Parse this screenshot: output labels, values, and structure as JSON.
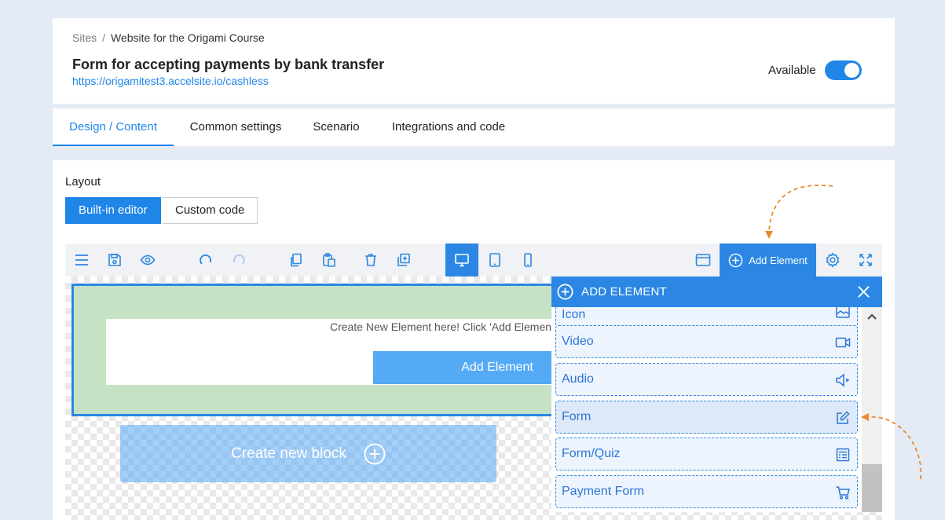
{
  "header": {
    "breadcrumb_root": "Sites",
    "breadcrumb_sep": "/",
    "breadcrumb_current": "Website for the Origami Course",
    "title": "Form for accepting payments by bank transfer",
    "url": "https://origamitest3.accelsite.io/cashless",
    "available_label": "Available",
    "available_on": true
  },
  "tabs": [
    {
      "label": "Design / Content",
      "active": true
    },
    {
      "label": "Common settings",
      "active": false
    },
    {
      "label": "Scenario",
      "active": false
    },
    {
      "label": "Integrations and code",
      "active": false
    }
  ],
  "layout": {
    "label": "Layout",
    "options": [
      {
        "label": "Built-in editor",
        "selected": true
      },
      {
        "label": "Custom code",
        "selected": false
      }
    ]
  },
  "toolbar": {
    "icons": [
      "menu-icon",
      "save-icon",
      "preview-icon",
      "undo-icon",
      "redo-icon",
      "copy-icon",
      "paste-icon",
      "delete-icon",
      "duplicate-icon",
      "desktop-icon",
      "tablet-icon",
      "mobile-icon",
      "browser-window-icon",
      "settings-icon",
      "fullscreen-icon"
    ],
    "active_device": "desktop",
    "add_element_label": "Add Element"
  },
  "canvas": {
    "placeholder_text": "Create New Element here! Click 'Add Element'",
    "add_element_label": "Add Element",
    "create_block_label": "Create new block"
  },
  "panel": {
    "title": "ADD ELEMENT",
    "partial_item": "Icon",
    "items": [
      {
        "label": "Video",
        "icon": "video-icon",
        "highlighted": false
      },
      {
        "label": "Audio",
        "icon": "speaker-icon",
        "highlighted": false
      },
      {
        "label": "Form",
        "icon": "edit-icon",
        "highlighted": true
      },
      {
        "label": "Form/Quiz",
        "icon": "quiz-icon",
        "highlighted": false
      },
      {
        "label": "Payment Form",
        "icon": "cart-icon",
        "highlighted": false
      }
    ]
  },
  "colors": {
    "accent": "#2b87e3",
    "link": "#1f86e8",
    "block_green": "#c5e3c4",
    "annotation_arrow": "#e98a2f"
  }
}
